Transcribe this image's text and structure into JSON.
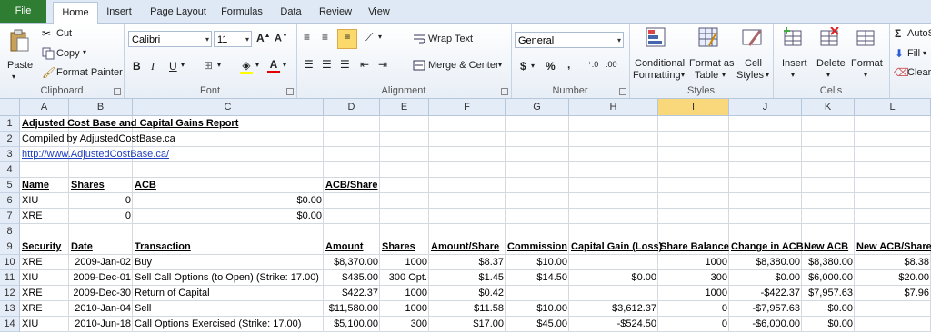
{
  "tabs": [
    "File",
    "Home",
    "Insert",
    "Page Layout",
    "Formulas",
    "Data",
    "Review",
    "View"
  ],
  "ribbon": {
    "clipboard": {
      "paste": "Paste",
      "cut": "Cut",
      "copy": "Copy",
      "format_painter": "Format Painter",
      "label": "Clipboard"
    },
    "font": {
      "name": "Calibri",
      "size": "11",
      "label": "Font"
    },
    "alignment": {
      "wrap_text": "Wrap Text",
      "merge_center": "Merge & Center",
      "label": "Alignment"
    },
    "number": {
      "format": "General",
      "label": "Number",
      "currency": "$",
      "percent": "%",
      "comma": ","
    },
    "styles": {
      "conditional": "Conditional",
      "formatting": "Formatting",
      "format_as": "Format as",
      "table": "Table",
      "cell": "Cell",
      "cell_styles": "Styles",
      "label": "Styles"
    },
    "cells": {
      "insert": "Insert",
      "delete": "Delete",
      "format": "Format",
      "label": "Cells"
    },
    "editing": {
      "autosum": "AutoS",
      "fill": "Fill",
      "clear": "Clear"
    }
  },
  "columns": [
    "A",
    "B",
    "C",
    "D",
    "E",
    "F",
    "G",
    "H",
    "I",
    "J",
    "K",
    "L"
  ],
  "selected_column": "I",
  "rows": [
    {
      "n": "1",
      "cells": {
        "A": "Adjusted Cost Base and Capital Gains Report"
      }
    },
    {
      "n": "2",
      "cells": {
        "A": "Compiled by AdjustedCostBase.ca"
      }
    },
    {
      "n": "3",
      "cells": {
        "A": "http://www.AdjustedCostBase.ca/"
      }
    },
    {
      "n": "4",
      "cells": {}
    },
    {
      "n": "5",
      "cells": {
        "A": "Name",
        "B": "Shares",
        "C": "ACB",
        "D": "ACB/Share"
      }
    },
    {
      "n": "6",
      "cells": {
        "A": "XIU",
        "B": "0",
        "C": "$0.00"
      }
    },
    {
      "n": "7",
      "cells": {
        "A": "XRE",
        "B": "0",
        "C": "$0.00"
      }
    },
    {
      "n": "8",
      "cells": {}
    },
    {
      "n": "9",
      "cells": {
        "A": "Security",
        "B": "Date",
        "C": "Transaction",
        "D": "Amount",
        "E": "Shares",
        "F": "Amount/Share",
        "G": "Commission",
        "H": "Capital Gain (Loss)",
        "I": "Share Balance",
        "J": "Change in ACB",
        "K": "New ACB",
        "L": "New ACB/Share"
      }
    },
    {
      "n": "10",
      "cells": {
        "A": "XRE",
        "B": "2009-Jan-02",
        "C": "Buy",
        "D": "$8,370.00",
        "E": "1000",
        "F": "$8.37",
        "G": "$10.00",
        "I": "1000",
        "J": "$8,380.00",
        "K": "$8,380.00",
        "L": "$8.38"
      }
    },
    {
      "n": "11",
      "cells": {
        "A": "XIU",
        "B": "2009-Dec-01",
        "C": "Sell Call Options (to Open) (Strike: 17.00)",
        "D": "$435.00",
        "E": "300 Opt.",
        "F": "$1.45",
        "G": "$14.50",
        "H": "$0.00",
        "I": "300",
        "J": "$0.00",
        "K": "$6,000.00",
        "L": "$20.00"
      }
    },
    {
      "n": "12",
      "cells": {
        "A": "XRE",
        "B": "2009-Dec-30",
        "C": "Return of Capital",
        "D": "$422.37",
        "E": "1000",
        "F": "$0.42",
        "I": "1000",
        "J": "-$422.37",
        "K": "$7,957.63",
        "L": "$7.96"
      }
    },
    {
      "n": "13",
      "cells": {
        "A": "XRE",
        "B": "2010-Jan-04",
        "C": "Sell",
        "D": "$11,580.00",
        "E": "1000",
        "F": "$11.58",
        "G": "$10.00",
        "H": "$3,612.37",
        "I": "0",
        "J": "-$7,957.63",
        "K": "$0.00"
      }
    },
    {
      "n": "14",
      "cells": {
        "A": "XIU",
        "B": "2010-Jun-18",
        "C": "Call Options Exercised (Strike: 17.00)",
        "D": "$5,100.00",
        "E": "300",
        "F": "$17.00",
        "G": "$45.00",
        "H": "-$524.50",
        "I": "0",
        "J": "-$6,000.00",
        "K": "$0.00"
      }
    }
  ]
}
